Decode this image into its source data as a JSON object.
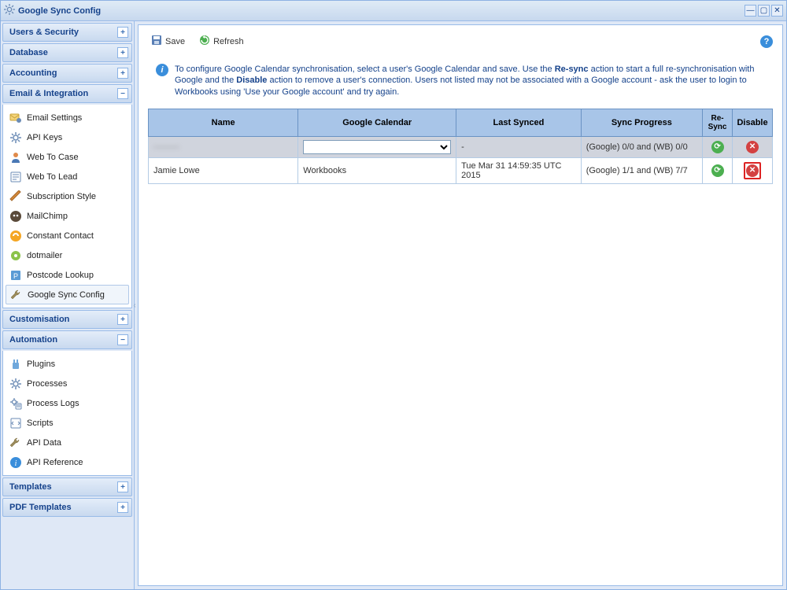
{
  "window": {
    "title": "Google Sync Config"
  },
  "sidebar": {
    "sections": [
      {
        "label": "Users & Security",
        "state": "+"
      },
      {
        "label": "Database",
        "state": "+"
      },
      {
        "label": "Accounting",
        "state": "+"
      },
      {
        "label": "Email & Integration",
        "state": "−",
        "items": [
          {
            "label": "Email Settings",
            "icon": "mail-config-icon"
          },
          {
            "label": "API Keys",
            "icon": "gear-icon"
          },
          {
            "label": "Web To Case",
            "icon": "person-icon"
          },
          {
            "label": "Web To Lead",
            "icon": "form-icon"
          },
          {
            "label": "Subscription Style",
            "icon": "brush-icon"
          },
          {
            "label": "MailChimp",
            "icon": "mailchimp-icon"
          },
          {
            "label": "Constant Contact",
            "icon": "constantcontact-icon"
          },
          {
            "label": "dotmailer",
            "icon": "dotmailer-icon"
          },
          {
            "label": "Postcode Lookup",
            "icon": "postcode-icon"
          },
          {
            "label": "Google Sync Config",
            "icon": "wrench-icon",
            "selected": true
          }
        ]
      },
      {
        "label": "Customisation",
        "state": "+"
      },
      {
        "label": "Automation",
        "state": "−",
        "items": [
          {
            "label": "Plugins",
            "icon": "plugin-icon"
          },
          {
            "label": "Processes",
            "icon": "gear-icon"
          },
          {
            "label": "Process Logs",
            "icon": "gear-log-icon"
          },
          {
            "label": "Scripts",
            "icon": "script-icon"
          },
          {
            "label": "API Data",
            "icon": "wrench-icon"
          },
          {
            "label": "API Reference",
            "icon": "info-icon"
          }
        ]
      },
      {
        "label": "Templates",
        "state": "+"
      },
      {
        "label": "PDF Templates",
        "state": "+"
      }
    ]
  },
  "toolbar": {
    "save_label": "Save",
    "refresh_label": "Refresh"
  },
  "info": {
    "text_pre": "To configure Google Calendar synchronisation, select a user's Google Calendar and save. Use the ",
    "bold1": "Re-sync",
    "text_mid1": " action to start a full re-synchronisation with Google and the ",
    "bold2": "Disable",
    "text_mid2": " action to remove a user's connection. Users not listed may not be associated with a Google account - ask the user to login to Workbooks using 'Use your Google account' and try again."
  },
  "table": {
    "columns": [
      "Name",
      "Google Calendar",
      "Last Synced",
      "Sync Progress",
      "Re-Sync",
      "Disable"
    ],
    "rows": [
      {
        "name": "———",
        "calendar": "",
        "last_synced": "-",
        "progress": "(Google) 0/0 and (WB) 0/0",
        "blurred": true,
        "calendar_is_select": true
      },
      {
        "name": "Jamie Lowe",
        "calendar": "Workbooks",
        "last_synced": "Tue Mar 31 14:59:35 UTC 2015",
        "progress": "(Google) 1/1 and (WB) 7/7",
        "disable_highlighted": true
      }
    ]
  }
}
